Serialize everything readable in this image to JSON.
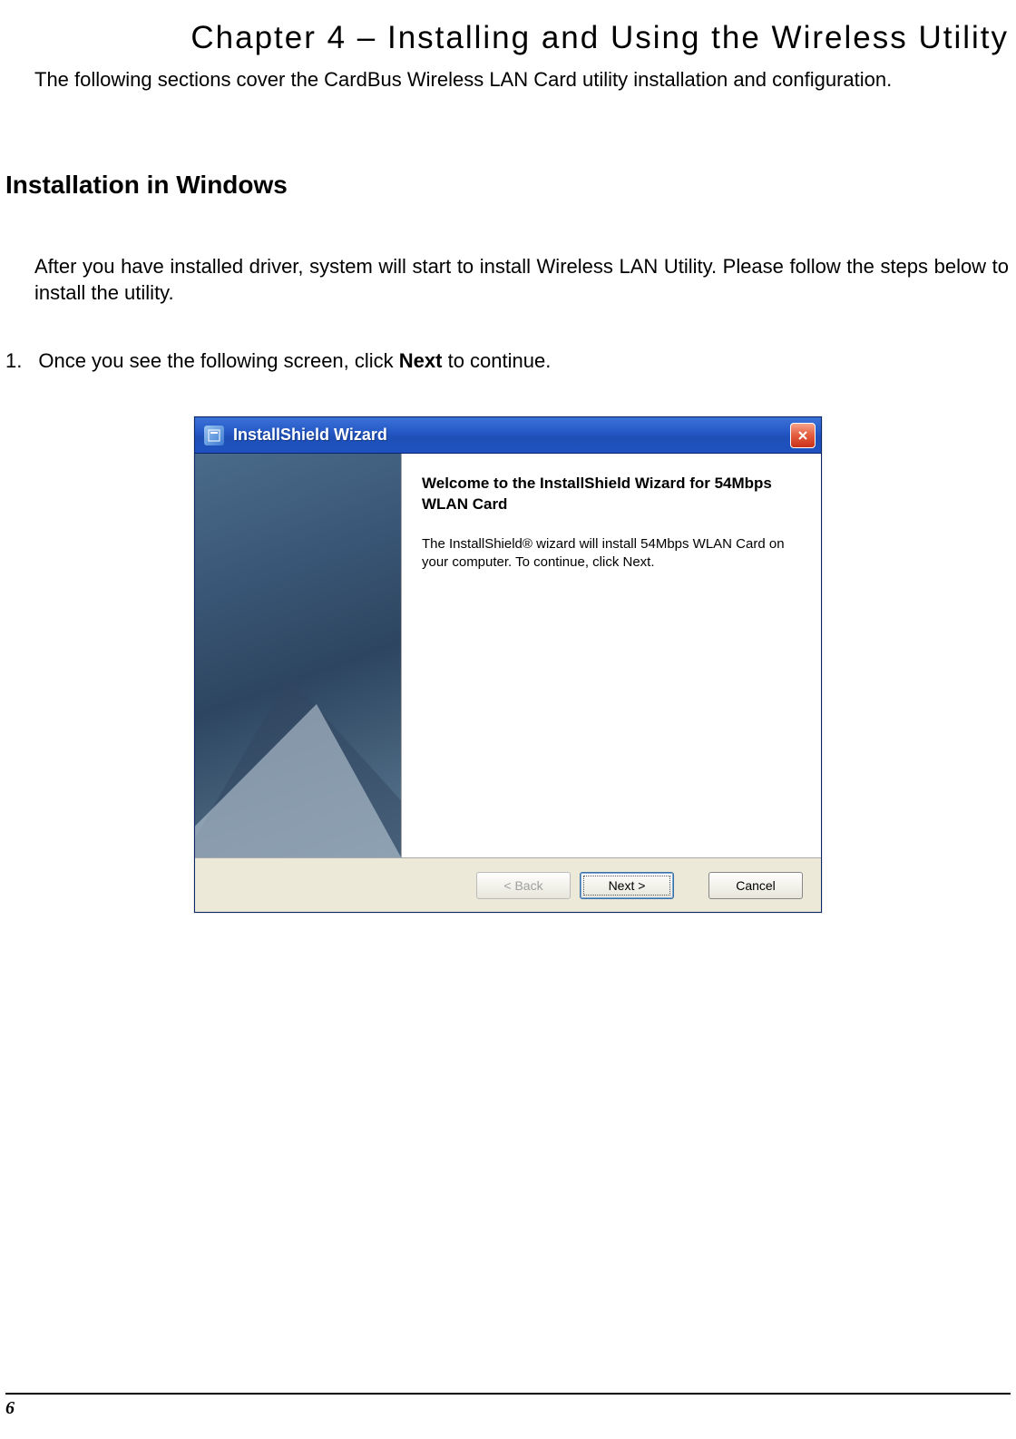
{
  "chapter_title": "Chapter 4 – Installing and Using the Wireless Utility",
  "intro": "The following sections cover the CardBus Wireless LAN Card utility installation and configuration.",
  "section_heading": "Installation in Windows",
  "body_text": "After you have installed driver, system will start to install Wireless LAN Utility. Please follow the steps below to install the utility.",
  "step": {
    "num": "1.",
    "prefix": "Once you see the following screen, click ",
    "bold": "Next",
    "suffix": " to continue."
  },
  "wizard": {
    "title": "InstallShield Wizard",
    "welcome_title": "Welcome to the InstallShield Wizard for 54Mbps WLAN Card",
    "welcome_desc": "The InstallShield® wizard will install 54Mbps WLAN Card on your computer.  To continue, click Next.",
    "buttons": {
      "back": "< Back",
      "next": "Next >",
      "cancel": "Cancel"
    }
  },
  "page_number": "6"
}
